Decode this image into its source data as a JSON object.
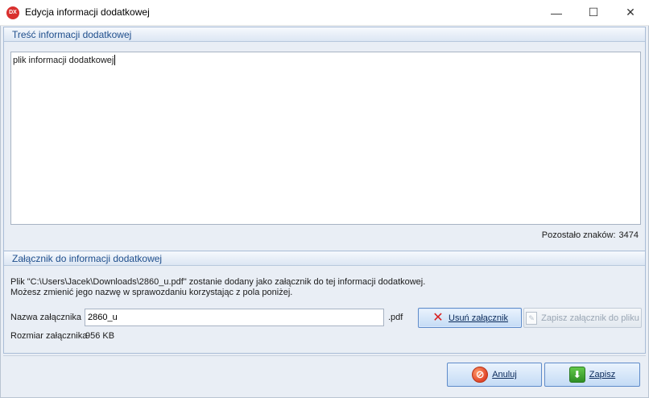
{
  "window": {
    "app_icon_label": "DX",
    "title": "Edycja informacji dodatkowej",
    "min_glyph": "—",
    "max_glyph": "☐",
    "close_glyph": "✕"
  },
  "content_group": {
    "header": "Treść informacji dodatkowej",
    "text": "plik informacji dodatkowej",
    "remaining_label": "Pozostało znaków:",
    "remaining_value": "3474"
  },
  "attachment_group": {
    "header": "Załącznik do informacji dodatkowej",
    "info_line1": "Plik \"C:\\Users\\Jacek\\Downloads\\2860_u.pdf\" zostanie dodany jako załącznik do tej informacji dodatkowej.",
    "info_line2": "Możesz zmienić jego nazwę w sprawozdaniu korzystając z pola poniżej.",
    "name_label": "Nazwa załącznika",
    "name_value": "2860_u",
    "extension": ".pdf",
    "size_label": "Rozmiar załącznika",
    "size_value": "956 KB",
    "remove_button": {
      "icon": "x-icon",
      "label": "Usuń załącznik"
    },
    "save_file_button": {
      "icon": "document-icon",
      "label": "Zapisz załącznik do pliku"
    }
  },
  "footer": {
    "cancel_button": {
      "icon": "cancel-icon",
      "label": "Anuluj"
    },
    "save_button": {
      "icon": "save-download-icon",
      "label": "Zapisz"
    }
  },
  "colors": {
    "accent": "#1e4e8c",
    "client_bg": "#e9eef5",
    "remove_icon": "#d81f1f"
  }
}
